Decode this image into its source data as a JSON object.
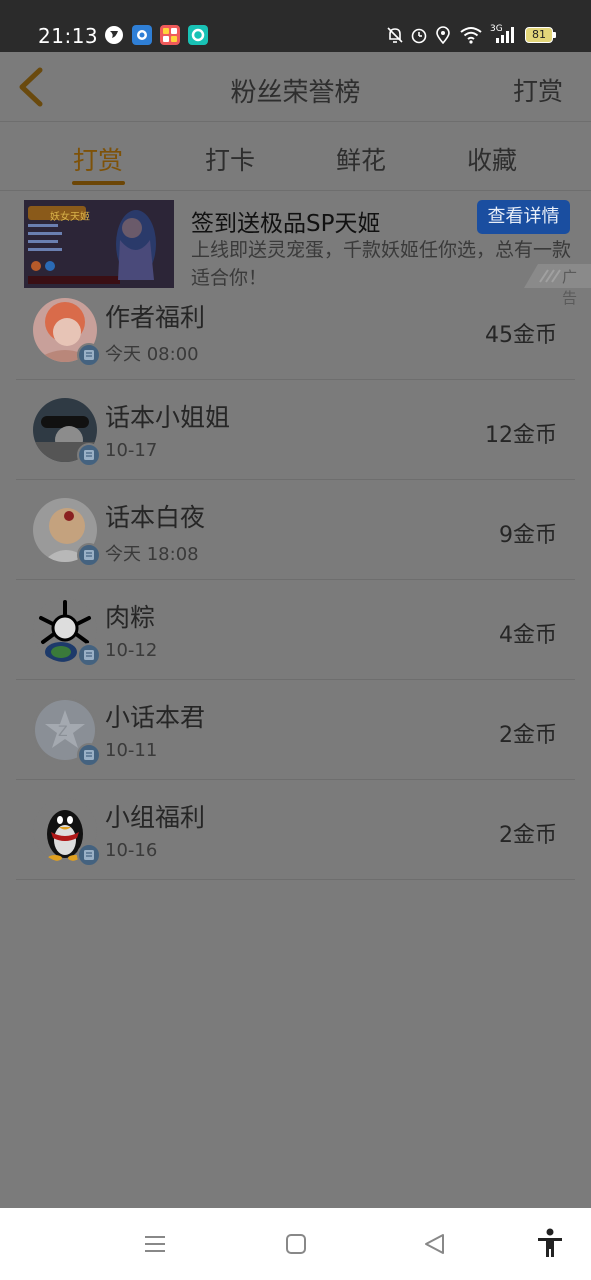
{
  "status_bar": {
    "time": "21:13",
    "battery": "81",
    "network": "3G",
    "icons": [
      "globe-app-icon",
      "blue-app-icon",
      "red-grid-app-icon",
      "teal-app-icon",
      "mute-bell-icon",
      "alarm-icon",
      "location-icon",
      "wifi-icon",
      "signal-icon",
      "battery-icon"
    ]
  },
  "header": {
    "title": "粉丝荣誉榜",
    "action": "打赏",
    "back_icon": "chevron-left-icon"
  },
  "tabs": [
    {
      "label": "打赏",
      "active": true
    },
    {
      "label": "打卡",
      "active": false
    },
    {
      "label": "鲜花",
      "active": false
    },
    {
      "label": "收藏",
      "active": false
    }
  ],
  "ad": {
    "title": "签到送极品SP天姬",
    "description": "上线即送灵宠蛋，千款妖姬任你选，总有一款适合你！",
    "button": "查看详情",
    "label": "广告",
    "image_caption": "妖女天姬"
  },
  "fans": [
    {
      "name": "作者福利",
      "time": "今天 08:00",
      "amount": "45金币"
    },
    {
      "name": "话本小姐姐",
      "time": "10-17",
      "amount": "12金币"
    },
    {
      "name": "话本白夜",
      "time": "今天 18:08",
      "amount": "9金币"
    },
    {
      "name": "肉粽",
      "time": "10-12",
      "amount": "4金币"
    },
    {
      "name": "小话本君",
      "time": "10-11",
      "amount": "2金币"
    },
    {
      "name": "小组福利",
      "time": "10-16",
      "amount": "2金币"
    }
  ],
  "nav_bar": {
    "icons": [
      "menu-icon",
      "home-square-icon",
      "back-triangle-icon",
      "accessibility-icon"
    ]
  },
  "colors": {
    "overlay_background": "#7b7b7b",
    "active_tab": "#7e5208",
    "ad_button": "#1a4ea0",
    "badge": "#44627f"
  }
}
